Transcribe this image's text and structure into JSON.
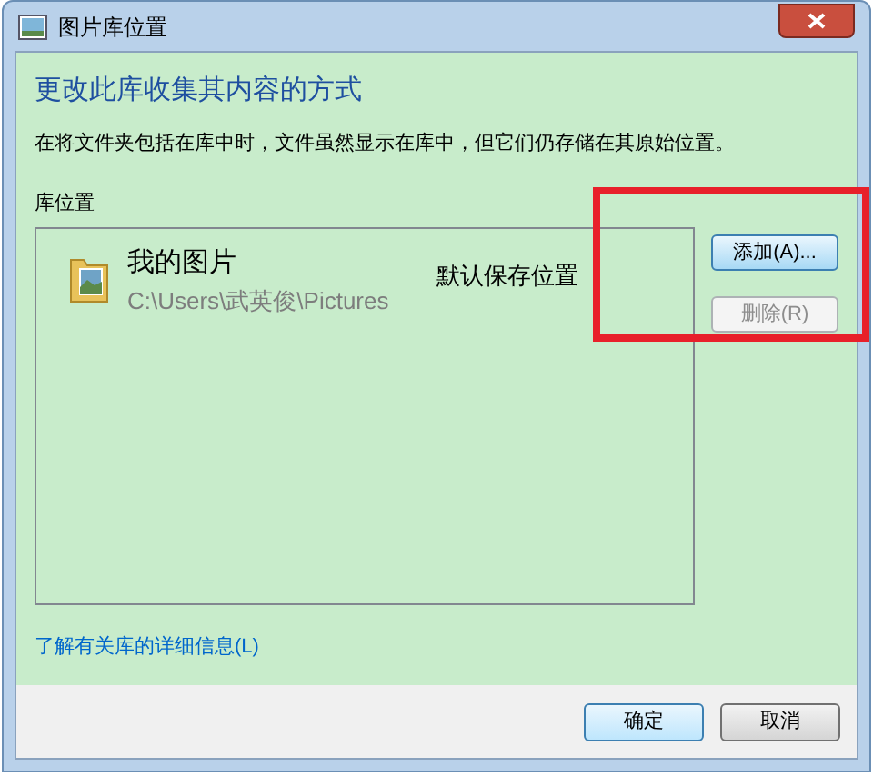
{
  "window": {
    "title": "图片库位置"
  },
  "heading": "更改此库收集其内容的方式",
  "description": "在将文件夹包括在库中时，文件虽然显示在库中，但它们仍存储在其原始位置。",
  "locations_label": "库位置",
  "locations": [
    {
      "name": "我的图片",
      "path": "C:\\Users\\武英俊\\Pictures",
      "note": "默认保存位置",
      "selected": false
    }
  ],
  "side_buttons": [
    {
      "label": "添加(A)...",
      "disabled": false,
      "focused": true
    },
    {
      "label": "删除(R)",
      "disabled": true,
      "focused": false
    }
  ],
  "link": "了解有关库的详细信息(L)",
  "buttons": [
    {
      "label": "确定",
      "default": true
    },
    {
      "label": "取消",
      "default": false
    }
  ]
}
